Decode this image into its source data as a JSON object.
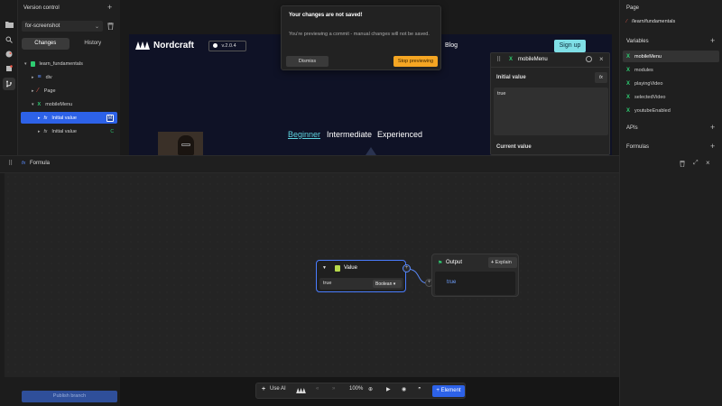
{
  "left_panel": {
    "title": "Version control",
    "branch": "for-screenshot",
    "tabs": [
      "Changes",
      "History"
    ],
    "tree": [
      {
        "label": "learn_fundamentals",
        "icon": "page-icon"
      },
      {
        "label": "div",
        "icon": "div-icon"
      },
      {
        "label": "Page",
        "icon": "page-element-icon"
      },
      {
        "label": "mobileMenu",
        "icon": "variable-icon"
      },
      {
        "label": "Initial value",
        "icon": "fx-icon",
        "badge": "M"
      },
      {
        "label": "Initial value",
        "icon": "fx-icon",
        "badge": "C"
      }
    ],
    "publish_label": "Publish branch"
  },
  "preview": {
    "logo": "Nordcraft",
    "version": "v.2.0.4",
    "nav_blog": "Blog",
    "sign_up": "Sign up",
    "levels": [
      "Beginner",
      "Intermediate",
      "Experienced"
    ]
  },
  "toast": {
    "title": "Your changes are not saved!",
    "body": "You're previewing a commit - manual changes will not be saved.",
    "dismiss": "Dismiss",
    "stop": "Stop previewing"
  },
  "variable_popover": {
    "title": "mobileMenu",
    "initial_label": "Initial value",
    "initial_value": "true",
    "current_label": "Current value",
    "fx": "fx"
  },
  "right_panel": {
    "page_label": "Page",
    "route": "/learn/fundamentals",
    "variables_label": "Variables",
    "variables": [
      "mobileMenu",
      "modules",
      "playingVideo",
      "selectedVideo",
      "youtubeEnabled"
    ],
    "apis_label": "APIs",
    "formulas_label": "Formulas"
  },
  "formula": {
    "title": "Formula",
    "value_node": {
      "title": "Value",
      "value": "true",
      "type": "Boolean"
    },
    "output_node": {
      "title": "Output",
      "explain": "Explain",
      "value": "true"
    }
  },
  "toolbar": {
    "use_ai": "Use AI",
    "zoom": "100%",
    "element": "Element"
  },
  "colors": {
    "accent_blue": "#2d62e8",
    "warning_orange": "#f5a623",
    "variable_green": "#2ecc71",
    "signup_cyan": "#7fdfe6"
  }
}
